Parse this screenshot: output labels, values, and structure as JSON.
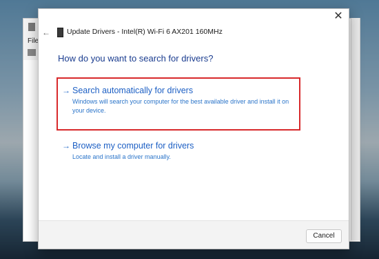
{
  "background_window": {
    "menu_file": "File"
  },
  "dialog": {
    "title": "Update Drivers - Intel(R) Wi-Fi 6 AX201 160MHz",
    "close_icon": "close-icon",
    "back_icon": "back-arrow-icon",
    "device_icon": "network-adapter-icon",
    "heading": "How do you want to search for drivers?",
    "options": [
      {
        "arrow": "→",
        "title": "Search automatically for drivers",
        "description": "Windows will search your computer for the best available driver and install it on your device.",
        "highlighted": true
      },
      {
        "arrow": "→",
        "title": "Browse my computer for drivers",
        "description": "Locate and install a driver manually.",
        "highlighted": false
      }
    ],
    "cancel_label": "Cancel"
  },
  "colors": {
    "heading": "#1a3c8f",
    "link": "#1c5fc4",
    "highlight_border": "#d8282a"
  }
}
